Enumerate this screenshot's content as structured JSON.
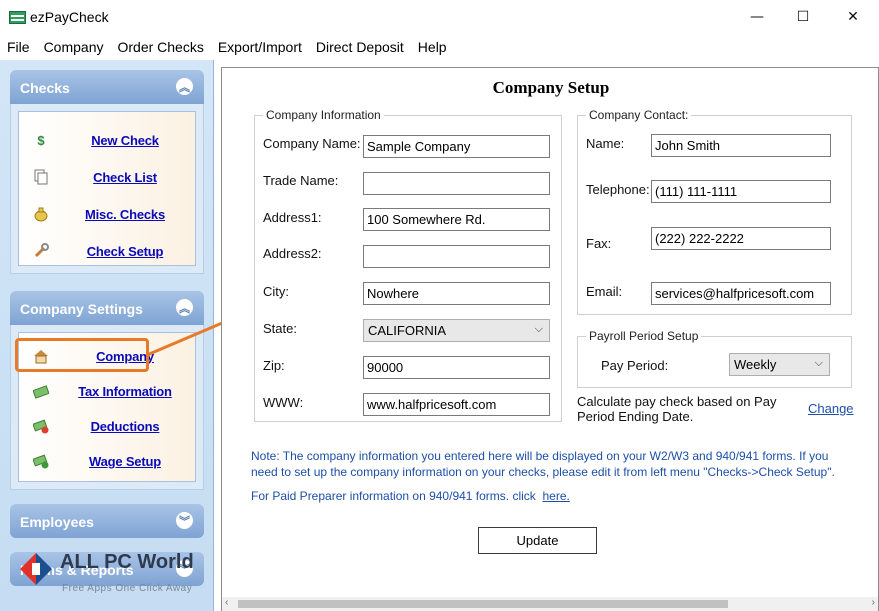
{
  "window": {
    "title": "ezPayCheck",
    "minimize": "—",
    "maximize": "☐",
    "close": "✕"
  },
  "menu": [
    "File",
    "Company",
    "Order Checks",
    "Export/Import",
    "Direct Deposit",
    "Help"
  ],
  "sidebar": {
    "checks": {
      "title": "Checks",
      "items": [
        {
          "label": "New Check",
          "icon": "dollar-icon"
        },
        {
          "label": "Check List",
          "icon": "documents-icon"
        },
        {
          "label": "Misc. Checks",
          "icon": "money-bag-icon"
        },
        {
          "label": "Check Setup",
          "icon": "wrench-icon"
        }
      ]
    },
    "company_settings": {
      "title": "Company Settings",
      "items": [
        {
          "label": "Company",
          "icon": "home-icon"
        },
        {
          "label": "Tax Information",
          "icon": "money-icon"
        },
        {
          "label": "Deductions",
          "icon": "money-minus-icon"
        },
        {
          "label": "Wage Setup",
          "icon": "money-plus-icon"
        }
      ]
    },
    "employees": {
      "title": "Employees"
    },
    "forms": {
      "title": "Forms & Reports"
    }
  },
  "main": {
    "title": "Company Setup",
    "company_info": {
      "title": "Company Information",
      "fields": [
        {
          "label": "Company Name:",
          "value": "Sample Company"
        },
        {
          "label": "Trade Name:",
          "value": ""
        },
        {
          "label": "Address1:",
          "value": "100 Somewhere Rd."
        },
        {
          "label": "Address2:",
          "value": ""
        },
        {
          "label": "City:",
          "value": "Nowhere"
        },
        {
          "label": "State:",
          "value": "CALIFORNIA"
        },
        {
          "label": "Zip:",
          "value": "90000"
        },
        {
          "label": "WWW:",
          "value": "www.halfpricesoft.com"
        }
      ]
    },
    "company_contact": {
      "title": "Company Contact:",
      "fields": [
        {
          "label": "Name:",
          "value": "John Smith"
        },
        {
          "label": "Telephone:",
          "value": "(111) 111-1111"
        },
        {
          "label": "Fax:",
          "value": "(222) 222-2222"
        },
        {
          "label": "Email:",
          "value": "services@halfpricesoft.com"
        }
      ]
    },
    "payroll": {
      "title": "Payroll Period Setup",
      "pay_period_label": "Pay Period:",
      "pay_period_value": "Weekly",
      "calc_text_1": "Calculate pay check based on Pay",
      "calc_text_2": "Period Ending Date.",
      "change_link": "Change"
    },
    "note_1": "Note: The company information you entered here will be displayed on your W2/W3 and 940/941 forms.  If you",
    "note_2": "need to set up the company information on your checks, please edit it from left menu \"Checks->Check Setup\".",
    "preparer_text": "For Paid Preparer information on 940/941 forms.  click",
    "preparer_link": "here.",
    "update_button": "Update"
  },
  "watermark": {
    "title": "ALL PC World",
    "subtitle": "Free Apps One Click Away"
  }
}
